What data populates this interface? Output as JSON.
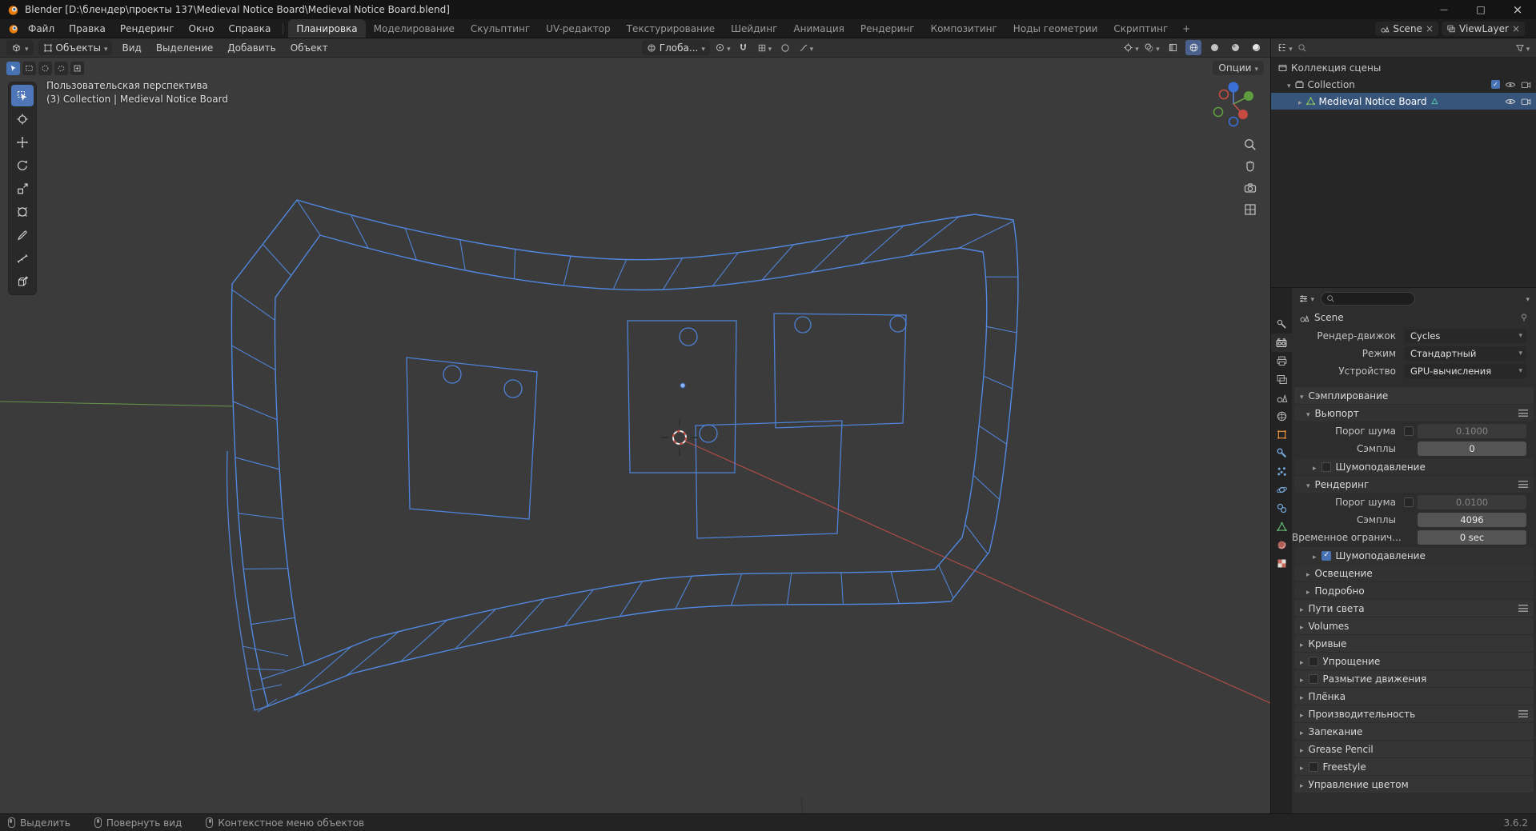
{
  "titlebar": {
    "title": "Blender [D:\\блендер\\проекты 137\\Medieval Notice Board\\Medieval Notice Board.blend]"
  },
  "topbar": {
    "menus": [
      "Файл",
      "Правка",
      "Рендеринг",
      "Окно",
      "Справка"
    ],
    "workspaces": [
      "Планировка",
      "Моделирование",
      "Скульптинг",
      "UV-редактор",
      "Текстурирование",
      "Шейдинг",
      "Анимация",
      "Рендеринг",
      "Композитинг",
      "Ноды геометрии",
      "Скриптинг"
    ],
    "active_workspace": "Планировка",
    "add_workspace": "+",
    "scene": "Scene",
    "viewlayer": "ViewLayer"
  },
  "viewport": {
    "mode": "Объекты",
    "menus": [
      "Вид",
      "Выделение",
      "Добавить",
      "Объект"
    ],
    "orientation": "Глоба...",
    "options": "Опции",
    "overlay_line1": "Пользовательская перспектива",
    "overlay_line2": "(3) Collection | Medieval Notice Board"
  },
  "outliner": {
    "rows": [
      {
        "label": "Коллекция сцены"
      },
      {
        "label": "Collection"
      },
      {
        "label": "Medieval Notice Board"
      }
    ]
  },
  "props": {
    "breadcrumb": "Scene",
    "engine_label": "Рендер-движок",
    "engine_value": "Cycles",
    "feature_label": "Режим",
    "feature_value": "Стандартный",
    "device_label": "Устройство",
    "device_value": "GPU-вычисления",
    "sampling": "Сэмплирование",
    "viewport": "Вьюпорт",
    "vp_noise_label": "Порог шума",
    "vp_noise_value": "0.1000",
    "vp_samples_label": "Сэмплы",
    "vp_samples_value": "0",
    "vp_denoise": "Шумоподавление",
    "render": "Рендеринг",
    "r_noise_label": "Порог шума",
    "r_noise_value": "0.0100",
    "r_samples_label": "Сэмплы",
    "r_samples_value": "4096",
    "r_time_label": "Временное огранич...",
    "r_time_value": "0 sec",
    "r_denoise": "Шумоподавление",
    "lights": "Освещение",
    "advanced": "Подробно",
    "collapsed": [
      {
        "label": "Пути света"
      },
      {
        "label": "Volumes"
      },
      {
        "label": "Кривые"
      },
      {
        "label": "Упрощение"
      },
      {
        "label": "Размытие движения"
      },
      {
        "label": "Плёнка"
      },
      {
        "label": "Производительность"
      },
      {
        "label": "Запекание"
      },
      {
        "label": "Grease Pencil"
      },
      {
        "label": "Freestyle"
      },
      {
        "label": "Управление цветом"
      }
    ]
  },
  "statusbar": {
    "items": [
      "Выделить",
      "Повернуть вид",
      "Контекстное меню объектов"
    ],
    "version": "3.6.2"
  },
  "colors": {
    "accent": "#4772b3",
    "wire_blue": "#5188e0",
    "selection_row": "#37547a",
    "axis_x": "#c0504a",
    "axis_y": "#6faa4a"
  },
  "icons": [
    "blender-logo-icon",
    "search-icon",
    "filter-icon",
    "eye-icon",
    "camera-icon",
    "magnet-icon",
    "pin-icon",
    "hamburger-icon",
    "mouse-left-icon",
    "mouse-middle-icon",
    "mouse-right-icon"
  ]
}
